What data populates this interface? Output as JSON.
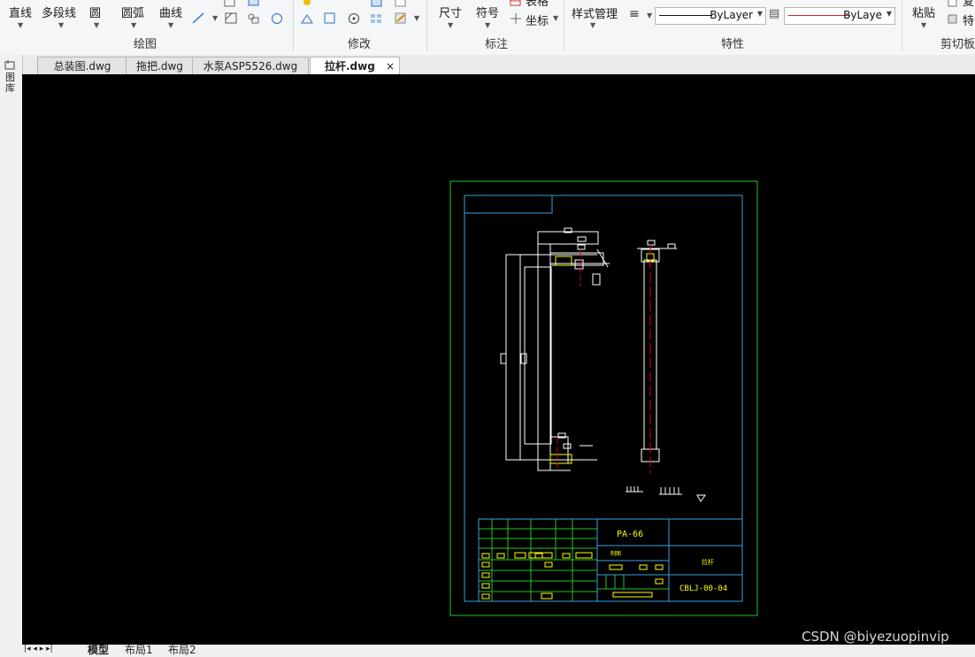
{
  "ribbon": {
    "draw_tools": {
      "line": "直线",
      "polyline": "多段线",
      "circle": "圆",
      "arc": "圆弧",
      "curve": "曲线"
    },
    "group_draw": "绘图",
    "group_modify": "修改",
    "dim": {
      "dimension": "尺寸",
      "symbol": "符号",
      "table_partial": "表格",
      "coord": "坐标"
    },
    "group_annotate": "标注",
    "style_manager": "样式管理",
    "bylayer_1": "ByLayer",
    "bylayer_2": "ByLaye",
    "group_props": "特性",
    "paste": "粘贴",
    "copy_partial": "复",
    "feature_partial": "特",
    "group_clipboard": "剪切板"
  },
  "tabs": [
    {
      "label": "总装图.dwg"
    },
    {
      "label": "拖把.dwg"
    },
    {
      "label": "水泵ASP5526.dwg"
    },
    {
      "label": "拉杆.dwg"
    }
  ],
  "side_text": "图库",
  "drawing": {
    "material": "PA-66",
    "drawing_no": "CBLJ-00-04",
    "part_name": "拉杆",
    "stamp": "制图"
  },
  "layout_tabs": {
    "model": "模型",
    "layout1": "布局1",
    "layout2": "布局2"
  },
  "watermark": "CSDN @biyezuopinvip",
  "colors": {
    "canvas_bg": "#000000",
    "frame_outer": "#22c322",
    "frame_inner": "#3aa0e0",
    "drawing": "#ffffff",
    "text": "#ffff00",
    "centerline": "#e00000"
  }
}
